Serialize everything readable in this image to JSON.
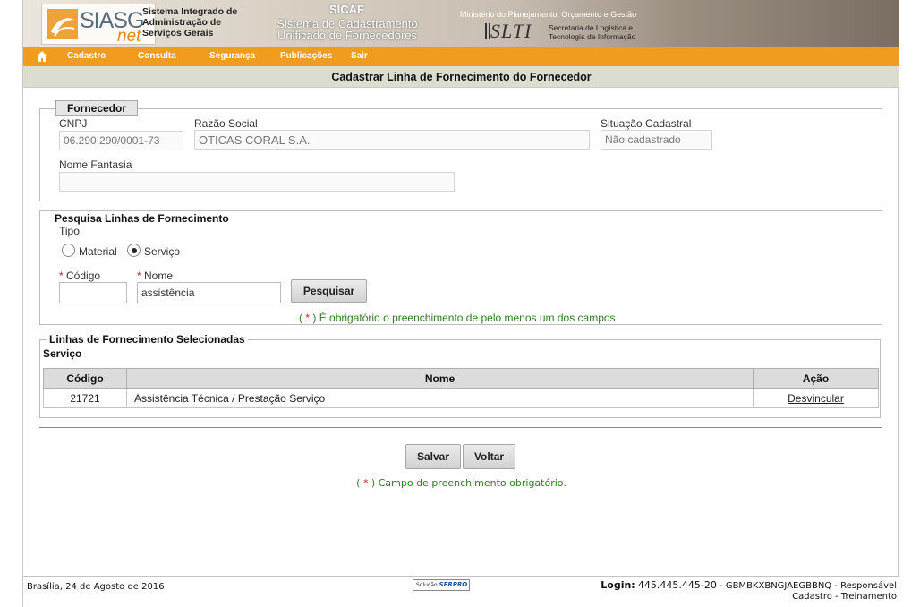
{
  "header": {
    "logo_main": "SIASG",
    "logo_sub": "net",
    "system_name_lines": [
      "Sistema Integrado de",
      "Administração de",
      "Serviços Gerais"
    ],
    "sicaf_title": "SICAF",
    "sicaf_sub_lines": [
      "Sistema de Cadastramento",
      "Unificado de Fornecedores"
    ],
    "ministry": "Ministério do Planejamento, Orçamento e Gestão",
    "slti_logo": "SLTI",
    "slti_lines": [
      "Secretaria de Logística e",
      "Tecnologia da Informação"
    ]
  },
  "nav": {
    "items": [
      "Cadastro",
      "Consulta",
      "Segurança",
      "Publicações",
      "Sair"
    ]
  },
  "page_title": "Cadastrar Linha de Fornecimento do Fornecedor",
  "fornecedor": {
    "legend": "Fornecedor",
    "cnpj_label": "CNPJ",
    "cnpj_value": "06.290.290/0001-73",
    "razao_label": "Razão Social",
    "razao_value": "OTICAS CORAL S.A.",
    "situacao_label": "Situação Cadastral",
    "situacao_value": "Não cadastrado",
    "fantasia_label": "Nome Fantasia",
    "fantasia_value": ""
  },
  "pesquisa": {
    "legend": "Pesquisa Linhas de Fornecimento",
    "tipo_label": "Tipo",
    "radio_material": "Material",
    "radio_servico": "Serviço",
    "selected": "Serviço",
    "req_mark": "*",
    "codigo_label": "Código",
    "codigo_value": "",
    "nome_label": "Nome",
    "nome_value": "assistência",
    "search_button": "Pesquisar",
    "note_open": "( ",
    "note_close": " )",
    "note_text": " É obrigatório o preenchimento de pelo menos um dos campos"
  },
  "selecionadas": {
    "legend": "Linhas de Fornecimento Selecionadas",
    "subtitle": "Serviço",
    "columns": [
      "Código",
      "Nome",
      "Ação"
    ],
    "rows": [
      {
        "codigo": "21721",
        "nome": "Assistência Técnica / Prestação Serviço",
        "acao": "Desvincular"
      }
    ]
  },
  "actions": {
    "save": "Salvar",
    "back": "Voltar",
    "req_note_open": "( ",
    "req_note_close": " )",
    "req_note_text": " Campo de preenchimento obrigatório."
  },
  "footer": {
    "date": "Brasília, 24 de Agosto de 2016",
    "serpro_prefix": "Solução",
    "serpro_brand": "SERPRO",
    "login_label": "Login:",
    "login_value": "445.445.445-20",
    "login_rest": " - GBMBKXBNGJAEGBBNQ - Responsável",
    "login_line2": "Cadastro - Treinamento"
  },
  "colors": {
    "nav_orange": "#f29c1f",
    "title_bar": "#dcdcd0",
    "note_green": "#2e7d22",
    "required_red": "#cc2222"
  }
}
